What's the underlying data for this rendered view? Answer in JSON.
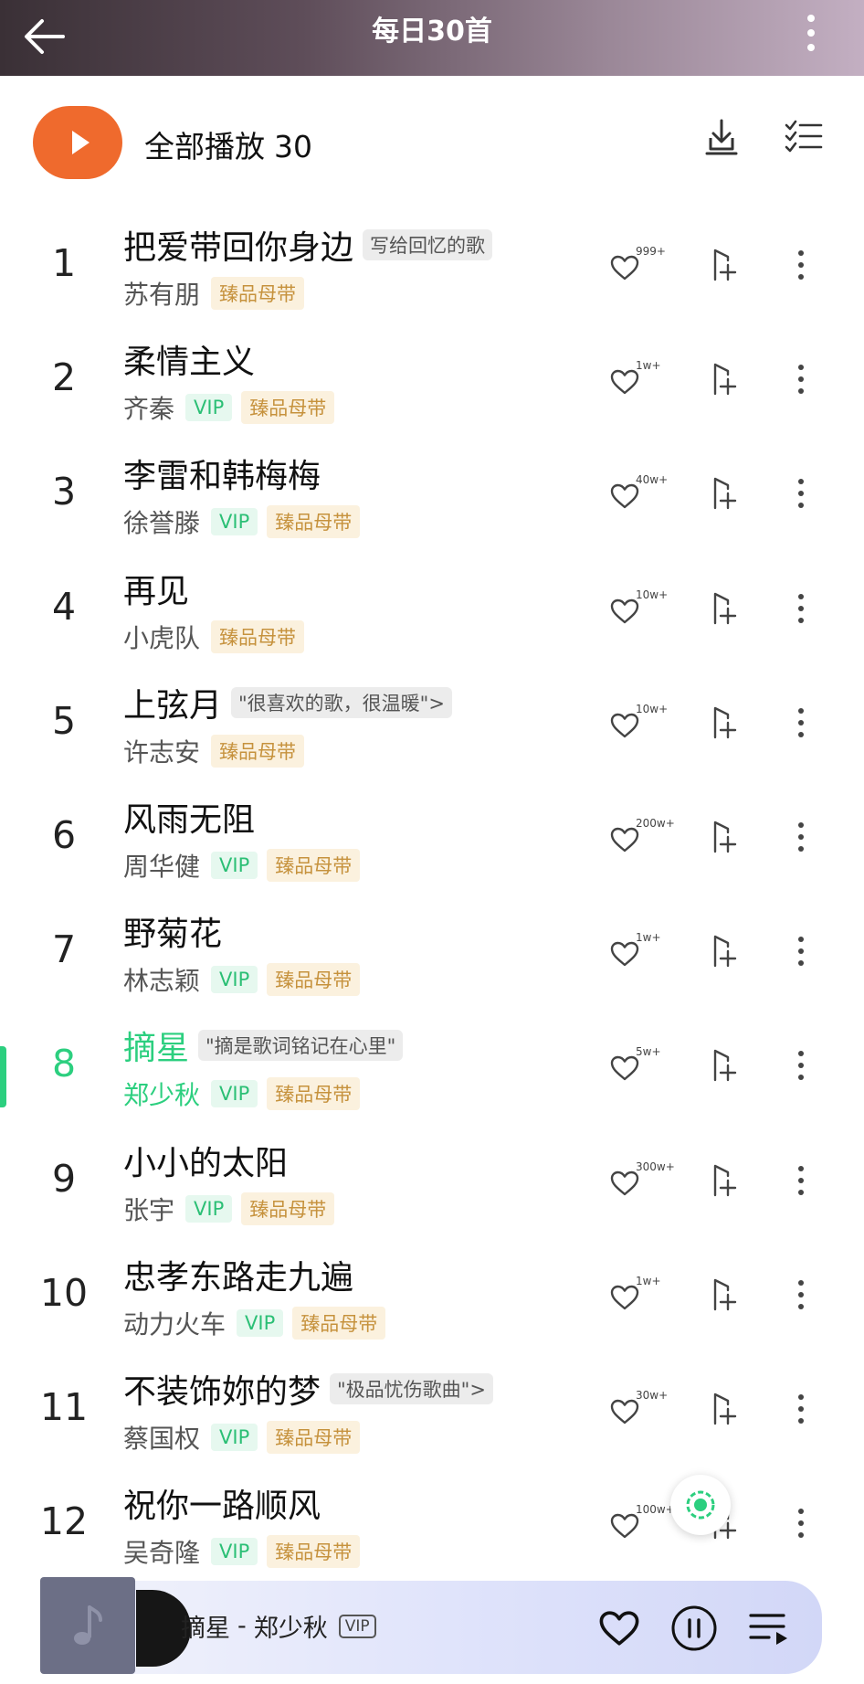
{
  "header": {
    "title": "每日30首",
    "back_icon": "arrow-left-icon",
    "more_icon": "more-vertical-icon",
    "gradient": [
      "#3a3036",
      "#c3afc2"
    ]
  },
  "play_all": {
    "label": "全部播放",
    "count": "30",
    "accent_color": "#ef6a2d"
  },
  "songs": [
    {
      "rank": "1",
      "title": "把爱带回你身边",
      "comment": "写给回忆的歌",
      "artist": "苏有朋",
      "vip": "",
      "master": "臻品母带",
      "likes": "999+",
      "current": false
    },
    {
      "rank": "2",
      "title": "柔情主义",
      "comment": "",
      "artist": "齐秦",
      "vip": "VIP",
      "master": "臻品母带",
      "likes": "1w+",
      "current": false
    },
    {
      "rank": "3",
      "title": "李雷和韩梅梅",
      "comment": "",
      "artist": "徐誉滕",
      "vip": "VIP",
      "master": "臻品母带",
      "likes": "40w+",
      "current": false
    },
    {
      "rank": "4",
      "title": "再见",
      "comment": "",
      "artist": "小虎队",
      "vip": "",
      "master": "臻品母带",
      "likes": "10w+",
      "current": false
    },
    {
      "rank": "5",
      "title": "上弦月",
      "comment": "\"很喜欢的歌，很温暖\">",
      "artist": "许志安",
      "vip": "",
      "master": "臻品母带",
      "likes": "10w+",
      "current": false
    },
    {
      "rank": "6",
      "title": "风雨无阻",
      "comment": "",
      "artist": "周华健",
      "vip": "VIP",
      "master": "臻品母带",
      "likes": "200w+",
      "current": false
    },
    {
      "rank": "7",
      "title": "野菊花",
      "comment": "",
      "artist": "林志颖",
      "vip": "VIP",
      "master": "臻品母带",
      "likes": "1w+",
      "current": false
    },
    {
      "rank": "8",
      "title": "摘星",
      "comment": "\"摘是歌词铭记在心里\"",
      "artist": "郑少秋",
      "vip": "VIP",
      "master": "臻品母带",
      "likes": "5w+",
      "current": true
    },
    {
      "rank": "9",
      "title": "小小的太阳",
      "comment": "",
      "artist": "张宇",
      "vip": "VIP",
      "master": "臻品母带",
      "likes": "300w+",
      "current": false
    },
    {
      "rank": "10",
      "title": "忠孝东路走九遍",
      "comment": "",
      "artist": "动力火车",
      "vip": "VIP",
      "master": "臻品母带",
      "likes": "1w+",
      "current": false
    },
    {
      "rank": "11",
      "title": "不装饰妳的梦",
      "comment": "\"极品忧伤歌曲\">",
      "artist": "蔡国权",
      "vip": "VIP",
      "master": "臻品母带",
      "likes": "30w+",
      "current": false
    },
    {
      "rank": "12",
      "title": "祝你一路顺风",
      "comment": "",
      "artist": "吴奇隆",
      "vip": "VIP",
      "master": "臻品母带",
      "likes": "100w+",
      "current": false
    }
  ],
  "current_accent": "#2ccf7f",
  "mini_player": {
    "song": "摘星",
    "separator": "-",
    "artist": "郑少秋",
    "vip": "VIP",
    "cover_icon": "music-note-icon",
    "like_icon": "heart-icon",
    "pause_icon": "pause-icon",
    "playlist_icon": "playlist-icon"
  }
}
